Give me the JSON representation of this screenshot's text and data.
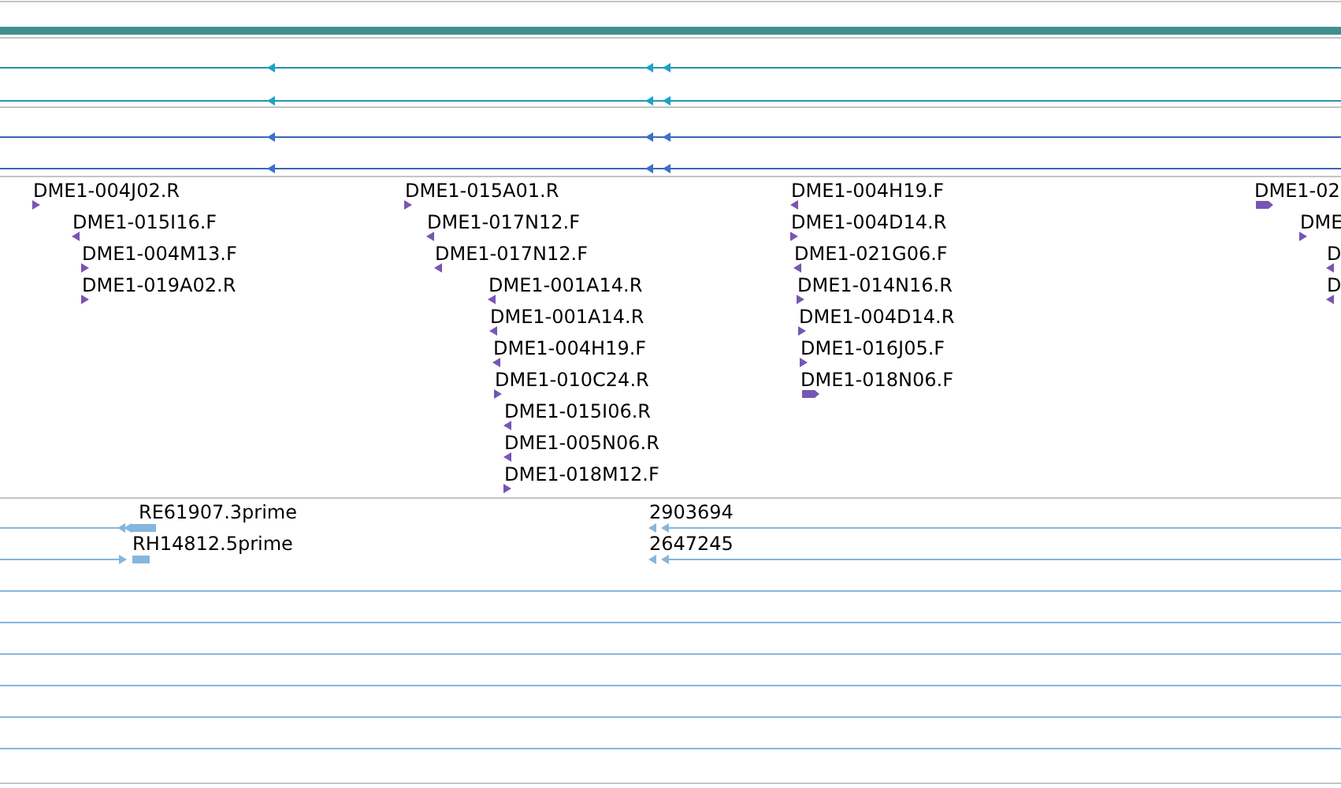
{
  "match_tracks": [
    {
      "kind": "teal",
      "rows": [
        {
          "forward": false
        },
        {
          "forward": false
        }
      ]
    },
    {
      "kind": "blue",
      "rows": [
        {
          "forward": false
        },
        {
          "forward": false
        }
      ]
    }
  ],
  "clone_features": [
    {
      "label": "DME1-004J02.R",
      "forward": true
    },
    {
      "label": "DME1-015I16.F",
      "forward": false
    },
    {
      "label": "DME1-004M13.F",
      "forward": true
    },
    {
      "label": "DME1-019A02.R",
      "forward": true
    },
    {
      "label": "DME1-015A01.R",
      "forward": true
    },
    {
      "label": "DME1-017N12.F",
      "forward": false
    },
    {
      "label": "DME1-017N12.F",
      "forward": false
    },
    {
      "label": "DME1-001A14.R",
      "forward": false
    },
    {
      "label": "DME1-001A14.R",
      "forward": false
    },
    {
      "label": "DME1-004H19.F",
      "forward": false
    },
    {
      "label": "DME1-010C24.R",
      "forward": true
    },
    {
      "label": "DME1-015I06.R",
      "forward": false
    },
    {
      "label": "DME1-005N06.R",
      "forward": false
    },
    {
      "label": "DME1-018M12.F",
      "forward": true
    },
    {
      "label": "DME1-004H19.F",
      "forward": false
    },
    {
      "label": "DME1-004D14.R",
      "forward": true
    },
    {
      "label": "DME1-021G06.F",
      "forward": false
    },
    {
      "label": "DME1-014N16.R",
      "forward": true
    },
    {
      "label": "DME1-004D14.R",
      "forward": true
    },
    {
      "label": "DME1-016J05.F",
      "forward": true
    },
    {
      "label": "DME1-018N06.F",
      "forward": true
    },
    {
      "label": "DME1-02",
      "forward": true
    },
    {
      "label": "DME",
      "forward": true
    },
    {
      "label": "D",
      "forward": false
    },
    {
      "label": "D",
      "forward": false
    }
  ],
  "est_features": [
    {
      "label": "RE61907.3prime",
      "forward": false
    },
    {
      "label": "RH14812.5prime",
      "forward": true
    },
    {
      "label": "2903694",
      "forward": false
    },
    {
      "label": "2647245",
      "forward": false
    }
  ],
  "empty_rows": [
    {
      "kind": "empty"
    },
    {
      "kind": "empty"
    },
    {
      "kind": "empty"
    },
    {
      "kind": "empty"
    },
    {
      "kind": "empty"
    },
    {
      "kind": "empty"
    }
  ]
}
